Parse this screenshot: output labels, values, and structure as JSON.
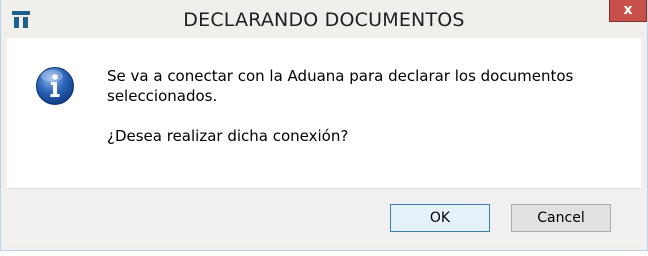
{
  "window": {
    "title": "DECLARANDO DOCUMENTOS",
    "close_label": "x"
  },
  "icons": {
    "app": "app-logo-icon",
    "message": "info-icon"
  },
  "message": {
    "line1": "Se va a conectar con la Aduana para declarar los documentos seleccionados.",
    "question": "¿Desea realizar dicha conexión?"
  },
  "buttons": {
    "ok_label": "OK",
    "cancel_label": "Cancel"
  },
  "colors": {
    "close_button": "#c7504a",
    "info_icon": "#2a63b8",
    "app_icon": "#1f5f8b"
  }
}
